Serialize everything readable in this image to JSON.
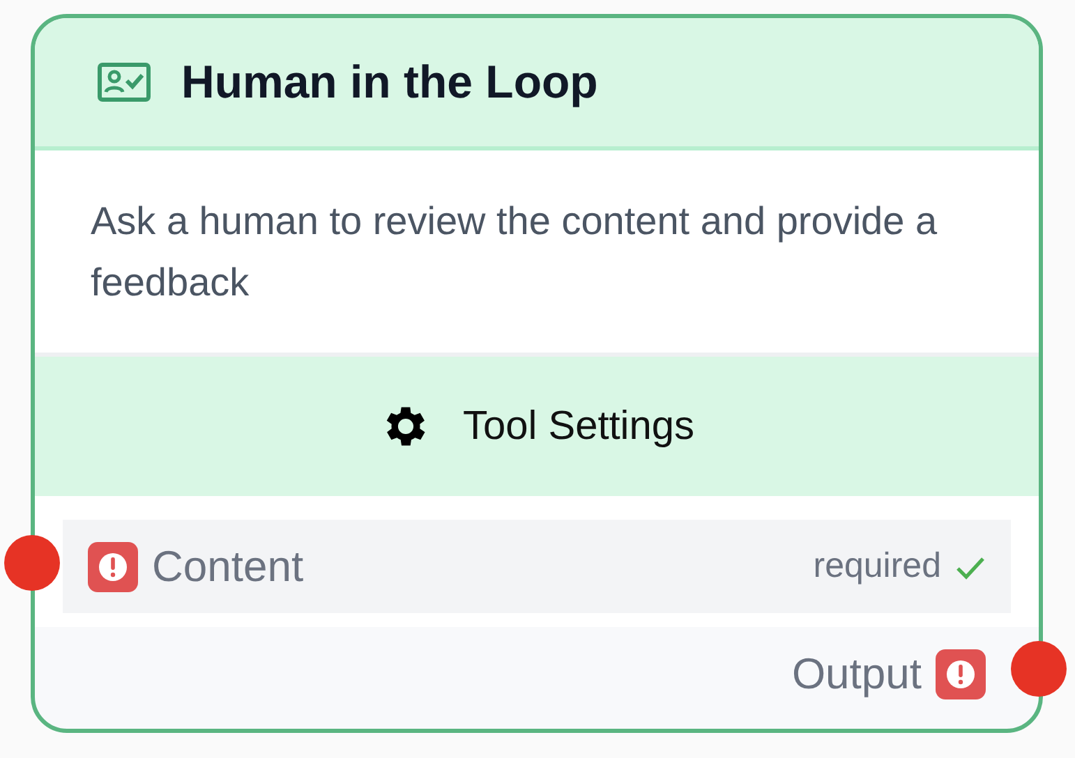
{
  "node": {
    "title": "Human in the Loop",
    "description": "Ask a human to review the content and provide a feedback",
    "settings_label": "Tool Settings"
  },
  "inputs": [
    {
      "label": "Content",
      "note": "required",
      "checked": true
    }
  ],
  "outputs": [
    {
      "label": "Output"
    }
  ]
}
